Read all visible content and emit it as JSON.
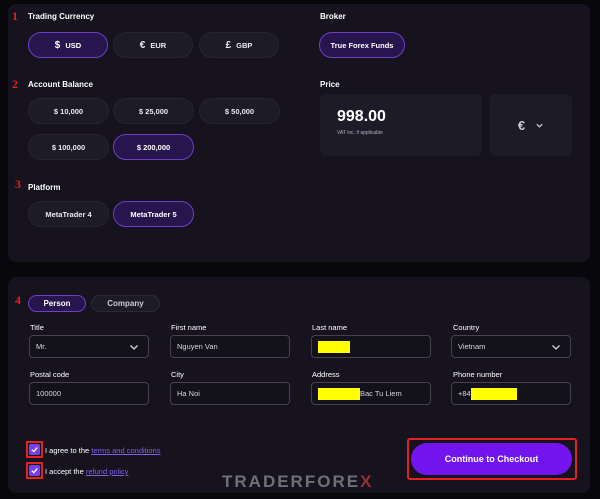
{
  "steps": [
    "1",
    "2",
    "3",
    "4"
  ],
  "trading_currency": {
    "label": "Trading Currency",
    "options": [
      {
        "symbol": "$",
        "code": "USD",
        "selected": true
      },
      {
        "symbol": "€",
        "code": "EUR",
        "selected": false
      },
      {
        "symbol": "£",
        "code": "GBP",
        "selected": false
      }
    ]
  },
  "broker": {
    "label": "Broker",
    "options": [
      {
        "name": "True Forex Funds",
        "selected": true
      }
    ]
  },
  "account_balance": {
    "label": "Account Balance",
    "options": [
      {
        "value": "$ 10,000",
        "selected": false
      },
      {
        "value": "$ 25,000",
        "selected": false
      },
      {
        "value": "$ 50,000",
        "selected": false
      },
      {
        "value": "$ 100,000",
        "selected": false
      },
      {
        "value": "$ 200,000",
        "selected": true
      }
    ]
  },
  "price": {
    "label": "Price",
    "value": "998.00",
    "note": "VAT inc. if applicable",
    "currency_symbol": "€"
  },
  "platform": {
    "label": "Platform",
    "options": [
      {
        "name": "MetaTrader 4",
        "selected": false
      },
      {
        "name": "MetaTrader 5",
        "selected": true
      }
    ]
  },
  "customer_type": {
    "tabs": [
      {
        "label": "Person",
        "active": true
      },
      {
        "label": "Company",
        "active": false
      }
    ]
  },
  "form": {
    "title": {
      "label": "Title",
      "value": "Mr."
    },
    "first_name": {
      "label": "First name",
      "value": "Nguyen Van"
    },
    "last_name": {
      "label": "Last name",
      "value": ""
    },
    "country": {
      "label": "Country",
      "value": "Vietnam"
    },
    "postal_code": {
      "label": "Postal code",
      "value": "100000"
    },
    "city": {
      "label": "City",
      "value": "Ha Noi"
    },
    "address": {
      "label": "Address",
      "value": "Bac Tu Liem"
    },
    "phone": {
      "label": "Phone number",
      "value": "+84"
    }
  },
  "agreements": {
    "terms": {
      "prefix": "I agree to the ",
      "link": "terms and conditions",
      "checked": true
    },
    "refund": {
      "prefix": "I accept the ",
      "link": "refund policy",
      "checked": true
    }
  },
  "checkout": {
    "label": "Continue to Checkout"
  },
  "watermark": {
    "left": "TRADERFOR",
    "right": "E",
    "x": "X"
  },
  "colors": {
    "background": "#07070c",
    "panel": "#16131f",
    "accent": "#7214ee",
    "selected_border": "#6b3fc9",
    "annotation_red": "#e0241d",
    "redaction": "#ffff00"
  }
}
